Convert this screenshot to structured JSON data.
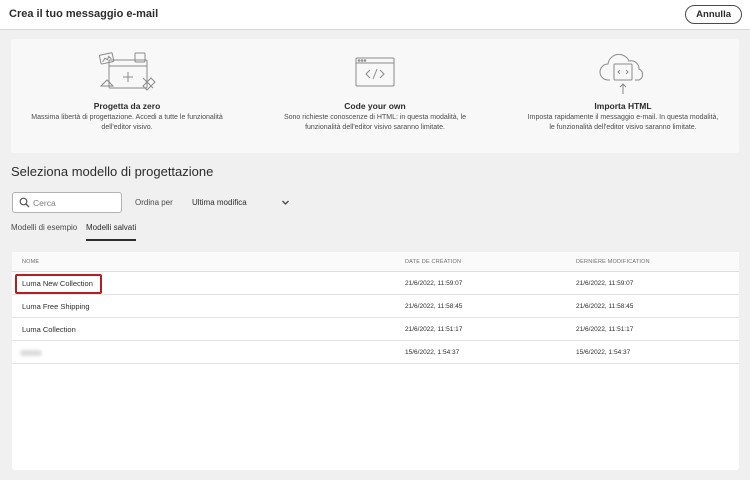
{
  "header": {
    "title": "Crea il tuo messaggio e-mail",
    "cancel_label": "Annulla"
  },
  "options": [
    {
      "icon": "design-canvas-icon",
      "title": "Progetta da zero",
      "description": "Massima libertà di progettazione. Accedi a tutte le funzionalità dell'editor visivo."
    },
    {
      "icon": "code-window-icon",
      "title": "Code your own",
      "description": "Sono richieste conoscenze di HTML: in questa modalità, le funzionalità dell'editor visivo saranno limitate."
    },
    {
      "icon": "cloud-upload-icon",
      "title": "Importa HTML",
      "description": "Imposta rapidamente il messaggio e-mail. In questa modalità, le funzionalità dell'editor visivo saranno limitate."
    }
  ],
  "section": {
    "title": "Seleziona modello di progettazione"
  },
  "search": {
    "placeholder": "Cerca"
  },
  "sort": {
    "label": "Ordina per",
    "value": "Ultima modifica"
  },
  "tabs": [
    {
      "label": "Modelli di esempio",
      "active": false
    },
    {
      "label": "Modelli salvati",
      "active": true
    }
  ],
  "table": {
    "columns": [
      "NOME",
      "DATE DE CRÉATION",
      "DERNIÈRE MODIFICATION"
    ],
    "rows": [
      {
        "name": "Luma New Collection",
        "created": "21/6/2022, 11:59:07",
        "modified": "21/6/2022, 11:59:07",
        "highlighted": true
      },
      {
        "name": "Luma Free Shipping",
        "created": "21/6/2022, 11:58:45",
        "modified": "21/6/2022, 11:58:45"
      },
      {
        "name": "Luma Collection",
        "created": "21/6/2022, 11:51:17",
        "modified": "21/6/2022, 11:51:17"
      },
      {
        "name": "",
        "created": "15/6/2022, 1:54:37",
        "modified": "15/6/2022, 1:54:37",
        "redacted": true
      }
    ]
  },
  "colors": {
    "highlight": "#b51f24",
    "background": "#f0f0f0"
  }
}
